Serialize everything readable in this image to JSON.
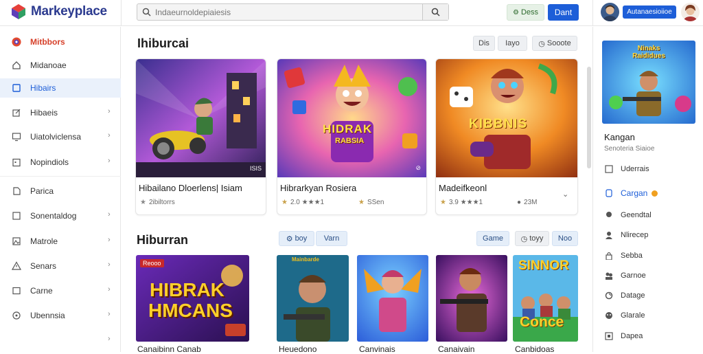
{
  "app": {
    "name": "Markeyplace"
  },
  "search": {
    "placeholder": "Indaeurnoldepiaiesis"
  },
  "header": {
    "green_button": "Dess",
    "blue_button": "Dant",
    "account_button": "Autanaesioiioe"
  },
  "sidebar": {
    "items": [
      {
        "label": "Mitbbors",
        "icon": "brand-logo-icon"
      },
      {
        "label": "Midanoae",
        "icon": "home-icon"
      },
      {
        "label": "Hibairs",
        "icon": "square-icon"
      },
      {
        "label": "Hibaeis",
        "icon": "edit-icon"
      },
      {
        "label": "Uiatolviclensa",
        "icon": "monitor-icon"
      },
      {
        "label": "Nopindiols",
        "icon": "calendar-icon"
      },
      {
        "label": "Parica",
        "icon": "tag-icon"
      },
      {
        "label": "Sonentaldog",
        "icon": "square-icon"
      },
      {
        "label": "Matrole",
        "icon": "image-icon"
      },
      {
        "label": "Senars",
        "icon": "warning-icon"
      },
      {
        "label": "Carne",
        "icon": "square-icon"
      },
      {
        "label": "Ubennsia",
        "icon": "circle-icon"
      }
    ]
  },
  "section1": {
    "title": "Ihiburcai",
    "chips": [
      "Dis",
      "Iayo",
      "Sooote"
    ],
    "cards": [
      {
        "title": "Hibailano Dloerlens| Isiam",
        "rating": "2ibiltorrs",
        "badge": "ISIS"
      },
      {
        "title": "Hibrarkyan Rosiera",
        "rating": "2.0 ★★★1",
        "rating2": "SSen"
      },
      {
        "title": "Madeifkeonl",
        "rating": "3.9 ★★★1",
        "rating2": "23M"
      }
    ],
    "card_art_text": [
      {
        "line1": "HIDRAK",
        "line2": "RABSIA"
      },
      {
        "line1": "KIBBNIS",
        "line2": ""
      }
    ]
  },
  "section2": {
    "title": "Hiburran",
    "chips_left": [
      "boy",
      "Varn"
    ],
    "chips_right": [
      "Game",
      "toyy",
      "Noo"
    ],
    "tiles": [
      {
        "title": "Canaibinn Canab",
        "art_line1": "HIBRAK",
        "art_line2": "HMCANS",
        "art_badge": "Reooo"
      },
      {
        "title": "Heuedono",
        "art_badge": "Mainbarde"
      },
      {
        "title": "Canvinais",
        "art_badge": ""
      },
      {
        "title": "Canaivain",
        "art_badge": ""
      },
      {
        "title": "Canbidoas",
        "art_line1": "SINNOR",
        "art_line2": "Conce"
      }
    ]
  },
  "right_panel": {
    "image_title": "Ninaks Raididues",
    "title": "Kangan",
    "subtitle": "Senoteria Siaioe",
    "items": [
      {
        "label": "Uderrais",
        "icon": "square-icon"
      },
      {
        "label": "Cargan",
        "icon": "phone-icon",
        "accent": true
      },
      {
        "label": "Geendtal",
        "icon": "location-icon"
      },
      {
        "label": "Nlirecep",
        "icon": "user-icon"
      },
      {
        "label": "Sebba",
        "icon": "lock-icon"
      },
      {
        "label": "Garnoe",
        "icon": "users-icon"
      },
      {
        "label": "Datage",
        "icon": "refresh-icon"
      },
      {
        "label": "Glarale",
        "icon": "face-icon"
      },
      {
        "label": "Dapea",
        "icon": "film-icon"
      }
    ]
  },
  "colors": {
    "accent": "#1d5ed8",
    "brand": "#2b3a8f",
    "brand_red": "#d6402a"
  }
}
